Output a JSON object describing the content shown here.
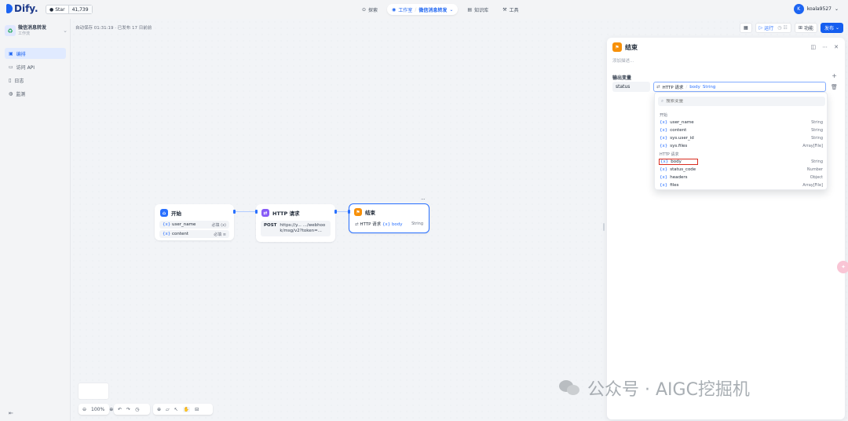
{
  "topbar": {
    "logo": "Dify.",
    "github_label": "Star",
    "github_count": "41,739",
    "nav": [
      {
        "label": "探索",
        "icon": "compass-icon"
      },
      {
        "label": "工作室",
        "sub": "微信消息转发",
        "icon": "robot-icon",
        "active": true
      },
      {
        "label": "知识库",
        "icon": "book-icon"
      },
      {
        "label": "工具",
        "icon": "tool-icon"
      }
    ],
    "user_initial": "K",
    "username": "koala9527"
  },
  "sidebar": {
    "app_name": "微信消息转发",
    "app_type": "工作流",
    "items": [
      {
        "label": "编排",
        "icon": "layout-icon",
        "active": true
      },
      {
        "label": "访问 API",
        "icon": "terminal-icon"
      },
      {
        "label": "日志",
        "icon": "file-icon"
      },
      {
        "label": "监测",
        "icon": "monitor-icon"
      }
    ]
  },
  "canvas": {
    "autosave": "自动保存 01:31:19 · 已发布 17 日前前",
    "nodes": {
      "start": {
        "title": "开始",
        "vars": [
          {
            "name": "user_name",
            "tag": "必填 (x)"
          },
          {
            "name": "content",
            "tag": "必填 ≡"
          }
        ]
      },
      "http": {
        "title": "HTTP 请求",
        "method": "POST",
        "url": "https://y... .../webhook/msg/v2?token=..."
      },
      "end": {
        "title": "结束",
        "out_source": "HTTP 请求",
        "out_var": "{x} body",
        "out_type": "String"
      }
    },
    "more": "...",
    "toolbar": {
      "zoom": "100%"
    }
  },
  "actions": {
    "run": "运行",
    "features": "功能",
    "publish": "发布"
  },
  "panel": {
    "title": "结束",
    "description_placeholder": "添加描述...",
    "output_label": "输出变量",
    "output_name": "status",
    "output_source": "HTTP 请求",
    "output_var": "body",
    "output_type": "String",
    "search_placeholder": "搜索变量",
    "groups": [
      {
        "name": "开始",
        "vars": [
          {
            "name": "user_name",
            "type": "String"
          },
          {
            "name": "content",
            "type": "String"
          },
          {
            "name": "sys.user_id",
            "type": "String"
          },
          {
            "name": "sys.files",
            "type": "Array[File]"
          }
        ]
      },
      {
        "name": "HTTP 请求",
        "vars": [
          {
            "name": "body",
            "type": "String",
            "highlight": true
          },
          {
            "name": "status_code",
            "type": "Number"
          },
          {
            "name": "headers",
            "type": "Object"
          },
          {
            "name": "files",
            "type": "Array[File]"
          }
        ]
      }
    ]
  },
  "watermark": "公众号 · AIGC挖掘机",
  "colors": {
    "accent": "#2970ff",
    "start_icon": "#2970ff",
    "http_icon": "#875bf7",
    "end_icon": "#f79009",
    "highlight": "#d92d20"
  }
}
